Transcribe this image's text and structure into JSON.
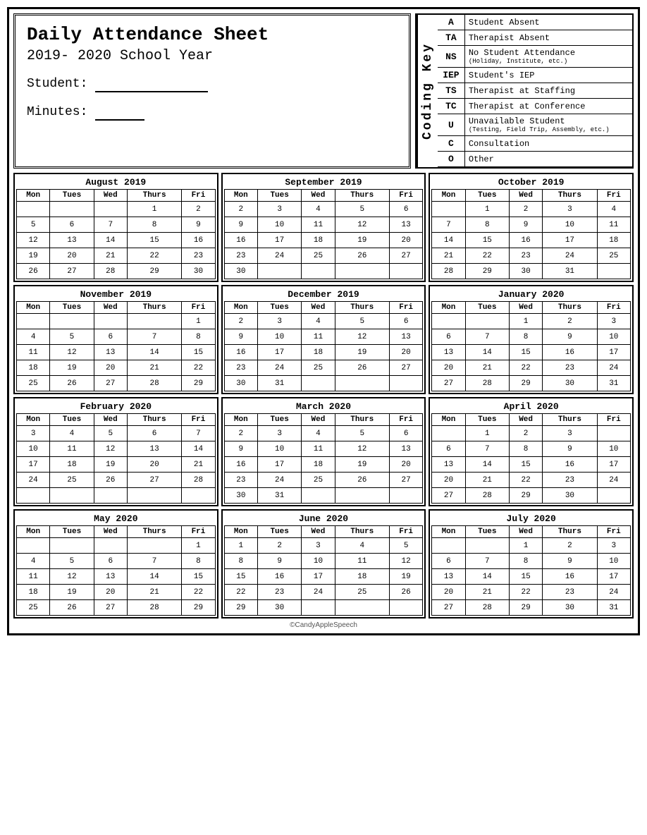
{
  "header": {
    "title": "Daily Attendance Sheet",
    "year": "2019- 2020 School Year",
    "student_label": "Student:",
    "minutes_label": "Minutes:"
  },
  "coding_key": {
    "label": "Coding Key",
    "items": [
      {
        "code": "A",
        "description": "Student Absent",
        "sub": ""
      },
      {
        "code": "TA",
        "description": "Therapist Absent",
        "sub": ""
      },
      {
        "code": "NS",
        "description": "No Student Attendance",
        "sub": "(Holiday, Institute, etc.)"
      },
      {
        "code": "IEP",
        "description": "Student's IEP",
        "sub": ""
      },
      {
        "code": "TS",
        "description": "Therapist at Staffing",
        "sub": ""
      },
      {
        "code": "TC",
        "description": "Therapist at Conference",
        "sub": ""
      },
      {
        "code": "U",
        "description": "Unavailable Student",
        "sub": "(Testing, Field Trip, Assembly, etc.)"
      },
      {
        "code": "C",
        "description": "Consultation",
        "sub": ""
      },
      {
        "code": "O",
        "description": "Other",
        "sub": ""
      }
    ]
  },
  "calendars": [
    {
      "month": "August 2019",
      "days": [
        [
          "",
          "",
          "",
          "1",
          "2"
        ],
        [
          "5",
          "6",
          "7",
          "8",
          "9"
        ],
        [
          "12",
          "13",
          "14",
          "15",
          "16"
        ],
        [
          "19",
          "20",
          "21",
          "22",
          "23"
        ],
        [
          "26",
          "27",
          "28",
          "29",
          "30"
        ]
      ]
    },
    {
      "month": "September 2019",
      "days": [
        [
          "2",
          "3",
          "4",
          "5",
          "6"
        ],
        [
          "9",
          "10",
          "11",
          "12",
          "13"
        ],
        [
          "16",
          "17",
          "18",
          "19",
          "20"
        ],
        [
          "23",
          "24",
          "25",
          "26",
          "27"
        ],
        [
          "30",
          "",
          "",
          "",
          ""
        ]
      ]
    },
    {
      "month": "October 2019",
      "days": [
        [
          "",
          "1",
          "2",
          "3",
          "4"
        ],
        [
          "7",
          "8",
          "9",
          "10",
          "11"
        ],
        [
          "14",
          "15",
          "16",
          "17",
          "18"
        ],
        [
          "21",
          "22",
          "23",
          "24",
          "25"
        ],
        [
          "28",
          "29",
          "30",
          "31",
          ""
        ]
      ]
    },
    {
      "month": "November 2019",
      "days": [
        [
          "",
          "",
          "",
          "",
          "1"
        ],
        [
          "4",
          "5",
          "6",
          "7",
          "8"
        ],
        [
          "11",
          "12",
          "13",
          "14",
          "15"
        ],
        [
          "18",
          "19",
          "20",
          "21",
          "22"
        ],
        [
          "25",
          "26",
          "27",
          "28",
          "29"
        ]
      ]
    },
    {
      "month": "December 2019",
      "days": [
        [
          "2",
          "3",
          "4",
          "5",
          "6"
        ],
        [
          "9",
          "10",
          "11",
          "12",
          "13"
        ],
        [
          "16",
          "17",
          "18",
          "19",
          "20"
        ],
        [
          "23",
          "24",
          "25",
          "26",
          "27"
        ],
        [
          "30",
          "31",
          "",
          "",
          ""
        ]
      ]
    },
    {
      "month": "January 2020",
      "days": [
        [
          "",
          "",
          "1",
          "2",
          "3"
        ],
        [
          "6",
          "7",
          "8",
          "9",
          "10"
        ],
        [
          "13",
          "14",
          "15",
          "16",
          "17"
        ],
        [
          "20",
          "21",
          "22",
          "23",
          "24"
        ],
        [
          "27",
          "28",
          "29",
          "30",
          "31"
        ]
      ]
    },
    {
      "month": "February 2020",
      "days": [
        [
          "3",
          "4",
          "5",
          "6",
          "7"
        ],
        [
          "10",
          "11",
          "12",
          "13",
          "14"
        ],
        [
          "17",
          "18",
          "19",
          "20",
          "21"
        ],
        [
          "24",
          "25",
          "26",
          "27",
          "28"
        ],
        [
          "",
          "",
          "",
          "",
          ""
        ]
      ]
    },
    {
      "month": "March 2020",
      "days": [
        [
          "2",
          "3",
          "4",
          "5",
          "6"
        ],
        [
          "9",
          "10",
          "11",
          "12",
          "13"
        ],
        [
          "16",
          "17",
          "18",
          "19",
          "20"
        ],
        [
          "23",
          "24",
          "25",
          "26",
          "27"
        ],
        [
          "30",
          "31",
          "",
          "",
          ""
        ]
      ]
    },
    {
      "month": "April 2020",
      "days": [
        [
          "",
          "1",
          "2",
          "3",
          ""
        ],
        [
          "6",
          "7",
          "8",
          "9",
          "10"
        ],
        [
          "13",
          "14",
          "15",
          "16",
          "17"
        ],
        [
          "20",
          "21",
          "22",
          "23",
          "24"
        ],
        [
          "27",
          "28",
          "29",
          "30",
          ""
        ]
      ]
    },
    {
      "month": "May 2020",
      "days": [
        [
          "",
          "",
          "",
          "",
          "1"
        ],
        [
          "4",
          "5",
          "6",
          "7",
          "8"
        ],
        [
          "11",
          "12",
          "13",
          "14",
          "15"
        ],
        [
          "18",
          "19",
          "20",
          "21",
          "22"
        ],
        [
          "25",
          "26",
          "27",
          "28",
          "29"
        ]
      ]
    },
    {
      "month": "June 2020",
      "days": [
        [
          "1",
          "2",
          "3",
          "4",
          "5"
        ],
        [
          "8",
          "9",
          "10",
          "11",
          "12"
        ],
        [
          "15",
          "16",
          "17",
          "18",
          "19"
        ],
        [
          "22",
          "23",
          "24",
          "25",
          "26"
        ],
        [
          "29",
          "30",
          "",
          "",
          ""
        ]
      ]
    },
    {
      "month": "July 2020",
      "days": [
        [
          "",
          "",
          "1",
          "2",
          "3"
        ],
        [
          "6",
          "7",
          "8",
          "9",
          "10"
        ],
        [
          "13",
          "14",
          "15",
          "16",
          "17"
        ],
        [
          "20",
          "21",
          "22",
          "23",
          "24"
        ],
        [
          "27",
          "28",
          "29",
          "30",
          "31"
        ]
      ]
    }
  ],
  "days_headers": [
    "Mon",
    "Tues",
    "Wed",
    "Thurs",
    "Fri"
  ],
  "footer": "©CandyAppleSpeech"
}
